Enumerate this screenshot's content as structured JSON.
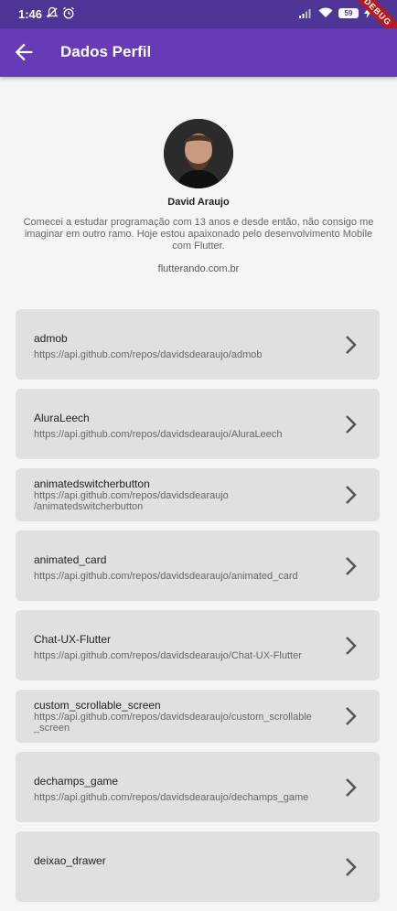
{
  "status_bar": {
    "time": "1:46",
    "battery": "59",
    "debug_label": "DEBUG"
  },
  "app_bar": {
    "title": "Dados Perfil"
  },
  "profile": {
    "name": "David Araujo",
    "bio": "Comecei a estudar programação com 13 anos e desde então, não consigo me imaginar em outro ramo. Hoje estou apaixonado pelo desenvolvimento Mobile com Flutter.",
    "site": "flutterando.com.br"
  },
  "repos": [
    {
      "name": "admob",
      "url": "https://api.github.com/repos/davidsdearaujo/admob"
    },
    {
      "name": "AluraLeech",
      "url": "https://api.github.com/repos/davidsdearaujo/AluraLeech"
    },
    {
      "name": "animatedswitcherbutton",
      "url": "https://api.github.com/repos/davidsdearaujo\n/animatedswitcherbutton"
    },
    {
      "name": "animated_card",
      "url": "https://api.github.com/repos/davidsdearaujo/animated_card"
    },
    {
      "name": "Chat-UX-Flutter",
      "url": "https://api.github.com/repos/davidsdearaujo/Chat-UX-Flutter"
    },
    {
      "name": "custom_scrollable_screen",
      "url": "https://api.github.com/repos/davidsdearaujo/custom_scrollable\n_screen"
    },
    {
      "name": "dechamps_game",
      "url": "https://api.github.com/repos/davidsdearaujo/dechamps_game"
    },
    {
      "name": "deixao_drawer",
      "url": ""
    }
  ],
  "colors": {
    "app_bar": "#673ab7",
    "status_bar": "#4f3596",
    "card": "#e0e0e0"
  }
}
